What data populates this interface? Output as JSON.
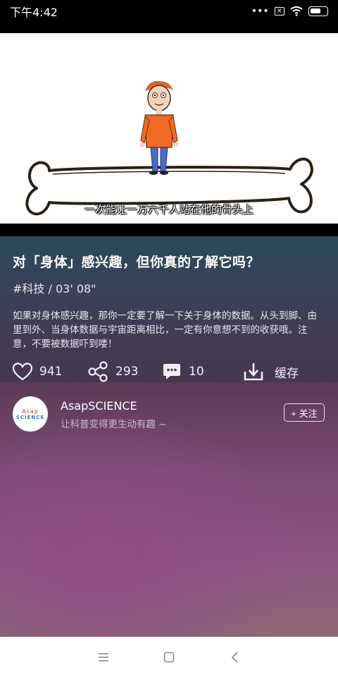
{
  "status_bar": {
    "time": "下午4:42",
    "dots": "•••",
    "sim_mark": "×"
  },
  "video": {
    "subtitle": "一次能让一万六千人站在他的骨头上"
  },
  "info": {
    "title": "对「身体」感兴趣，但你真的了解它吗？",
    "tag": "#科技 / 03' 08\"",
    "description": "如果对身体感兴趣，那你一定要了解一下关于身体的数据。从头到脚、由里到外、当身体数据与宇宙距离相比，一定有你意想不到的收获哦。注意，不要被数据吓到喽！",
    "actions": {
      "likes": "941",
      "shares": "293",
      "comments": "10",
      "cache_label": "缓存"
    }
  },
  "channel": {
    "avatar_top": "Asap",
    "avatar_bottom": "SCIENCE",
    "name": "AsapSCIENCE",
    "subtitle": "让科普变得更生动有趣 ~",
    "follow_label": "+ 关注"
  }
}
